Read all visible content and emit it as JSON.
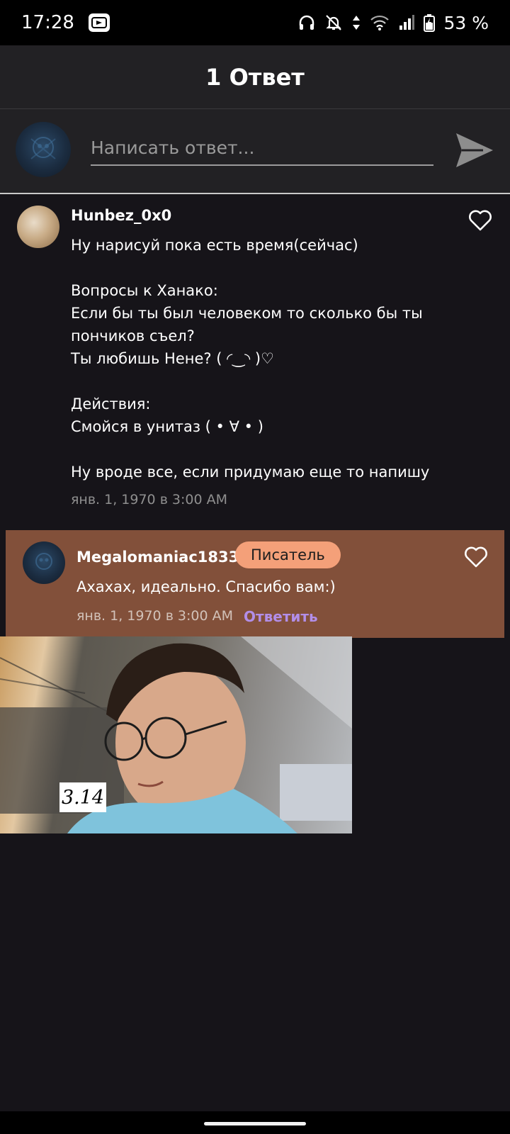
{
  "status_bar": {
    "time": "17:28",
    "battery": "53 %",
    "icons": [
      "screen-cast-icon",
      "headphones-icon",
      "mute-icon",
      "data-arrows-icon",
      "wifi-icon",
      "signal-icon",
      "battery-icon"
    ]
  },
  "header": {
    "title": "1 Ответ"
  },
  "reply_input": {
    "placeholder": "Написать ответ...",
    "send_icon": "send-icon"
  },
  "comment": {
    "author": "Hunbez_0x0",
    "body": "Ну нарисуй пока есть время(сейчас)\n\nВопросы к Ханако:\nЕсли бы ты был человеком то сколько бы ты пончиков съел?\nТы любишь Нене? ( ◜‿◝ )♡\n\nДействия:\nСмойся в унитаз ( • ∀ • )\n\nНу вроде все, если придумаю еще то напишу",
    "date": "янв. 1, 1970 в 3:00 AM",
    "like_icon": "heart-outline-icon"
  },
  "reply": {
    "author": "Megalomaniac1833",
    "role": "Писатель",
    "text": "Ахахах, идеально. Спасибо вам:)",
    "date": "янв. 1, 1970 в 3:00 AM",
    "action": "Ответить",
    "like_icon": "heart-outline-icon",
    "accent_color": "#82503a",
    "badge_color": "#f4a079",
    "action_color": "#b28ee8"
  },
  "attachment": {
    "label": "3.14"
  }
}
